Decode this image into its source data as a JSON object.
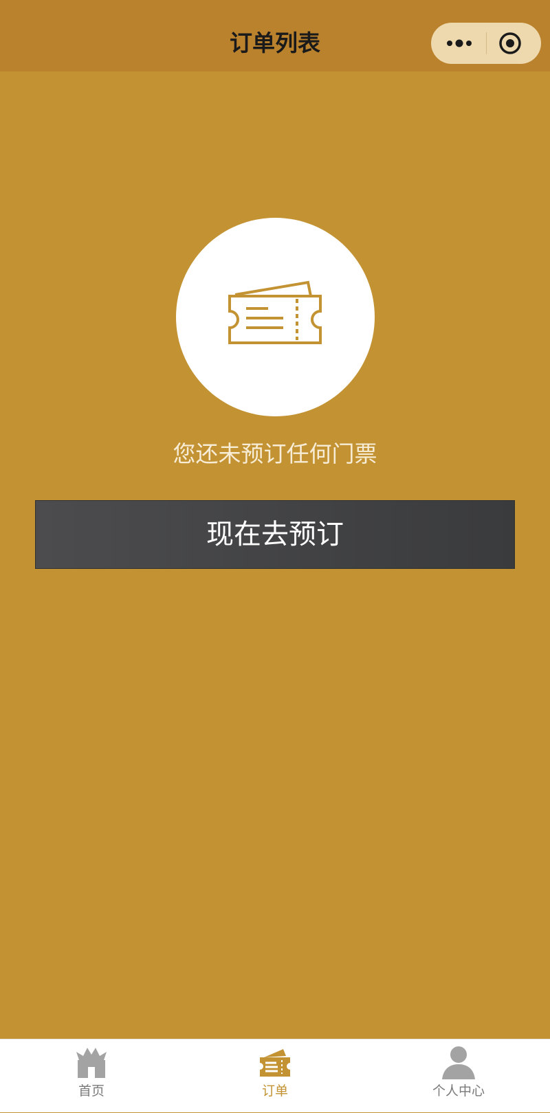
{
  "navbar": {
    "title": "订单列表",
    "background": "#BB822E",
    "capsule": {
      "more_icon": "more-dots-icon",
      "close_icon": "target-circle-icon"
    }
  },
  "main": {
    "background": "#C39333",
    "empty_state": {
      "icon": "ticket-icon",
      "message": "您还未预订任何门票"
    },
    "book_button_label": "现在去预订"
  },
  "tabbar": {
    "items": [
      {
        "label": "首页",
        "icon": "temple-home-icon",
        "active": false,
        "color": "#7a7a7a"
      },
      {
        "label": "订单",
        "icon": "ticket-order-icon",
        "active": true,
        "color": "#C39333"
      },
      {
        "label": "个人中心",
        "icon": "person-icon",
        "active": false,
        "color": "#7a7a7a"
      }
    ]
  }
}
